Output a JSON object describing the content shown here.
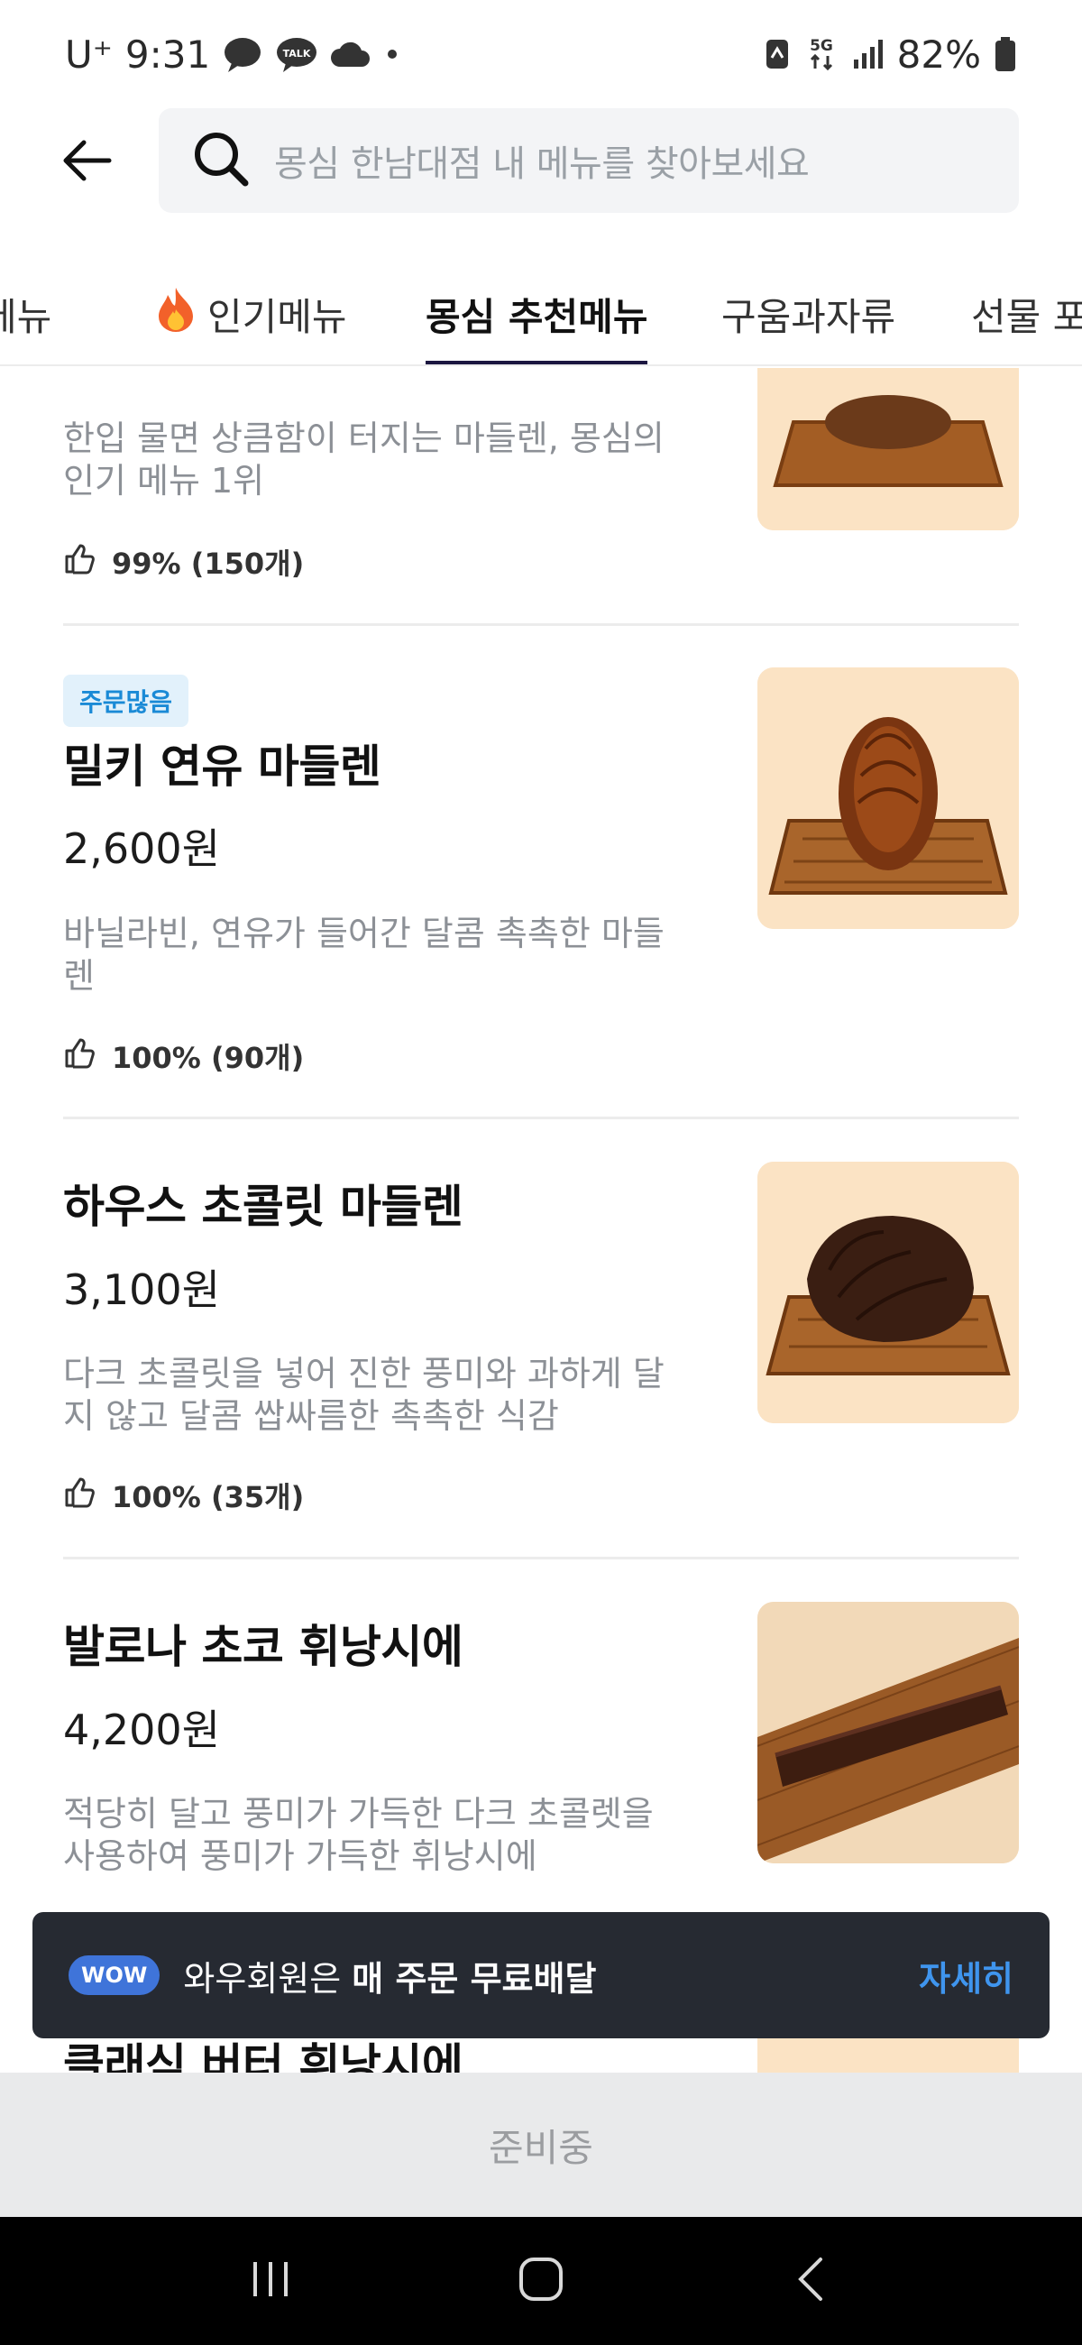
{
  "status_bar": {
    "carrier": "U⁺",
    "time": "9:31",
    "notif_icons": [
      "chat-bubble-icon",
      "talk-icon",
      "cloud-icon",
      "dot-icon"
    ],
    "talk_label": "TALK",
    "network": "5G",
    "battery": "82%"
  },
  "search": {
    "placeholder": "몽심 한남대점 내 메뉴를 찾아보세요"
  },
  "tabs": [
    {
      "label": "메뉴"
    },
    {
      "label": "인기메뉴",
      "icon": "fire-icon"
    },
    {
      "label": "몽심 추천메뉴",
      "active": true
    },
    {
      "label": "구움과자류"
    },
    {
      "label": "선물 포"
    }
  ],
  "items": [
    {
      "name": "",
      "price": "",
      "desc": "한입 물면 상큼함이 터지는 마들렌, 몽심의 인기 메뉴 1위",
      "rating": "99% (150개)"
    },
    {
      "badge": "주문많음",
      "name": "밀키 연유 마들렌",
      "price": "2,600원",
      "desc": "바닐라빈, 연유가 들어간 달콤 촉촉한 마들렌",
      "rating": "100% (90개)"
    },
    {
      "name": "하우스 초콜릿 마들렌",
      "price": "3,100원",
      "desc": "다크 초콜릿을 넣어 진한 풍미와 과하게 달지 않고 달콤 쌉싸름한 촉촉한 식감",
      "rating": "100% (35개)"
    },
    {
      "name": "발로나 초코 휘낭시에",
      "price": "4,200원",
      "desc": "적당히 달고 풍미가 가득한 다크 초콜렛을 사용하여 풍미가 가득한 휘낭시에"
    },
    {
      "name": "클래식 버터 휘낭시에"
    }
  ],
  "toast": {
    "badge": "WOW",
    "text": "와우회원은 ",
    "bold": "매 주문 무료배달",
    "link": "자세히"
  },
  "bottom_button": {
    "label": "준비중"
  },
  "colors": {
    "tab_underline": "#1b1640",
    "badge_bg": "#e2f1fb",
    "badge_text": "#1a8ad6",
    "toast_bg": "#262a32",
    "toast_link": "#3f95ee",
    "wow_badge": "#3f74d9"
  }
}
